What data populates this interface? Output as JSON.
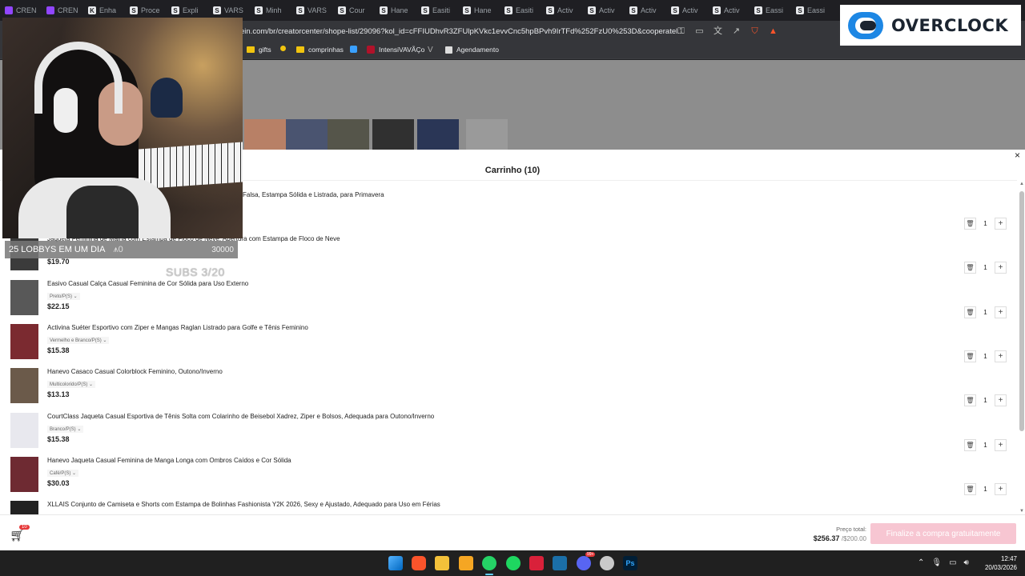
{
  "tabs": [
    {
      "icon": "twitch-icon",
      "label": "CREN"
    },
    {
      "icon": "twitch-icon",
      "label": "CREN"
    },
    {
      "icon": "k-icon",
      "label": "Enha"
    },
    {
      "icon": "s-icon",
      "label": "Proce"
    },
    {
      "icon": "s-icon",
      "label": "Expli"
    },
    {
      "icon": "s-icon",
      "label": "VARS"
    },
    {
      "icon": "s-icon",
      "label": "Minh"
    },
    {
      "icon": "s-icon",
      "label": "VARS"
    },
    {
      "icon": "s-icon",
      "label": "Cour"
    },
    {
      "icon": "s-icon",
      "label": "Hane"
    },
    {
      "icon": "s-icon",
      "label": "Easiti"
    },
    {
      "icon": "s-icon",
      "label": "Hane"
    },
    {
      "icon": "s-icon",
      "label": "Easiti"
    },
    {
      "icon": "s-icon",
      "label": "Activ"
    },
    {
      "icon": "s-icon",
      "label": "Activ"
    },
    {
      "icon": "s-icon",
      "label": "Activ"
    },
    {
      "icon": "s-icon",
      "label": "Activ"
    },
    {
      "icon": "s-icon",
      "label": "Activ"
    },
    {
      "icon": "s-icon",
      "label": "Eassi"
    },
    {
      "icon": "s-icon",
      "label": "Eassi"
    }
  ],
  "address_bar": {
    "url": "ein.com/br/creatorcenter/shope-list/29096?kol_id=cFFIUDhvR3ZFUlpKVkc1evvCnc5hpBPvh9IrTFd%252FzU0%253D&cooperatel..."
  },
  "bookmarks": {
    "gifts": "gifts",
    "comprinhas": "comprinhas",
    "intensivao": "IntensiVAVÃÇo",
    "agendamento": "Agendamento"
  },
  "cart": {
    "title": "Carrinho (10)",
    "close_glyph": "×",
    "items": [
      {
        "name": "Falsa, Estampa Sólida e Listrada, para Primavera",
        "variant": "",
        "price": "",
        "qty": "1"
      },
      {
        "name": "Jaqueta Feminina de Malha com Estampa de Floco de Neve, Abertura com Estampa de Floco de Neve",
        "variant": "",
        "price": "$19.70",
        "qty": "1"
      },
      {
        "name": "Easivo Casual Calça Casual Feminina de Cor Sólida para Uso Externo",
        "variant": "Preto/P(S)",
        "price": "$22.15",
        "qty": "1"
      },
      {
        "name": "Activina Suéter Esportivo com Ziper e Mangas Raglan Listrado para Golfe e Tênis Feminino",
        "variant": "Vermelho e Branco/P(S)",
        "price": "$15.38",
        "qty": "1"
      },
      {
        "name": "Hanevo Casaco Casual Colorblock Feminino, Outono/Inverno",
        "variant": "Multicolorido/P(S)",
        "price": "$13.13",
        "qty": "1"
      },
      {
        "name": "CourtClass Jaqueta Casual Esportiva de Tênis Solta com Colarinho de Beisebol Xadrez, Ziper e Bolsos, Adequada para Outono/Inverno",
        "variant": "Branco/P(S)",
        "price": "$15.38",
        "qty": "1"
      },
      {
        "name": "Hanevo Jaqueta Casual Feminina de Manga Longa com Ombros Caídos e Cor Sólida",
        "variant": "Café/P(S)",
        "price": "$30.03",
        "qty": "1"
      },
      {
        "name": "XLLAIS Conjunto de Camiseta e Shorts com Estampa de Bolinhas Fashionista Y2K 2026, Sexy e Ajustado, Adequado para Uso em Férias",
        "variant": "",
        "price": "",
        "qty": ""
      }
    ],
    "footer": {
      "badge": "10",
      "total_label": "Preço total:",
      "total": "$256.37",
      "total_limit": "/$200.00",
      "checkout_label": "Finalize a compra gratuitamente"
    }
  },
  "overlay": {
    "lobby_label": "25 LOBBYS EM UM DIA",
    "lobby_count": "0",
    "lobby_goal": "30000",
    "subs": "SUBS 3/20",
    "logo_text": "OVERCLOCK"
  },
  "taskbar": {
    "time": "12:47",
    "date": "20/03/2026",
    "discord_badge": "99+"
  },
  "colors": {
    "accent_pink": "#f7c6d2",
    "badge_red": "#e7393a",
    "taskbar": "#202020",
    "browser_chrome": "#35363a"
  }
}
